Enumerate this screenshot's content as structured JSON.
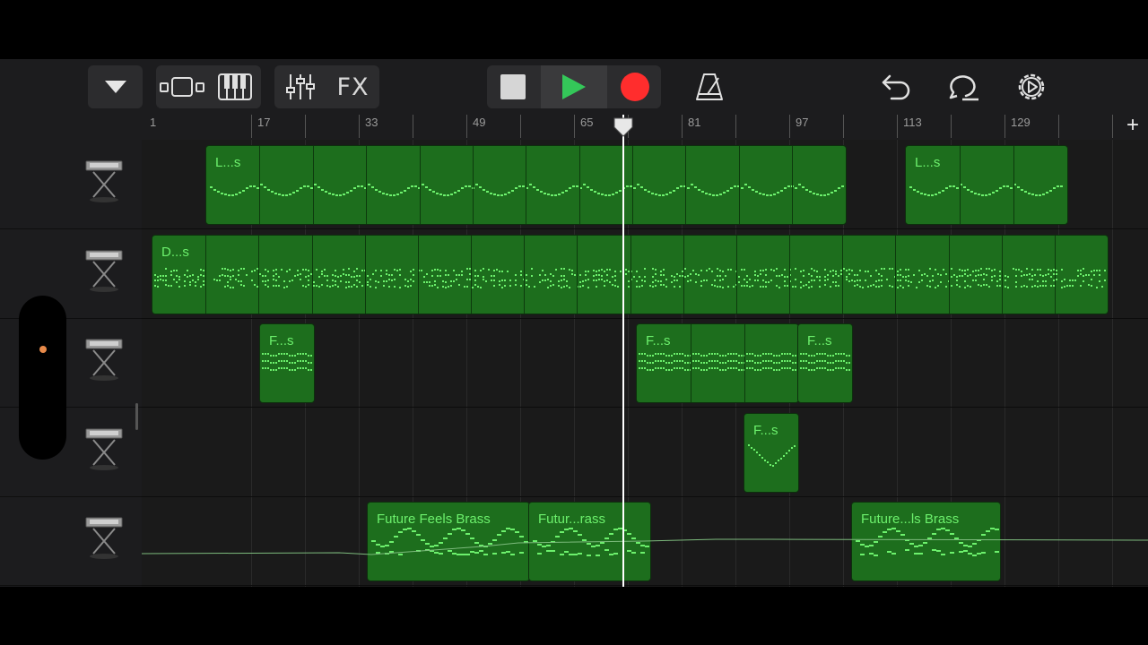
{
  "toolbar": {
    "fx_label": "FX",
    "icons": [
      "tracks-view-chevron-icon",
      "track-view-icon",
      "keyboard-icon",
      "mixer-icon",
      "stop-icon",
      "play-icon",
      "record-icon",
      "metronome-icon",
      "undo-icon",
      "loop-icon",
      "settings-icon"
    ],
    "colors": {
      "play": "#34c759",
      "record": "#ff2d2d",
      "region": "#1d6e1d",
      "notes": "#6cf06c"
    }
  },
  "ruler": {
    "labels": [
      "1",
      "17",
      "33",
      "49",
      "65",
      "81",
      "97",
      "113",
      "129"
    ],
    "add_label": "+"
  },
  "playhead_bar": 70,
  "tracks": [
    {
      "name": "track-1",
      "regions": [
        {
          "label": "L...s",
          "start": 9,
          "end": 104,
          "segments": 12,
          "pattern": "melody"
        },
        {
          "label": "L...s",
          "start": 113,
          "end": 137,
          "segments": 3,
          "pattern": "melody"
        }
      ]
    },
    {
      "name": "track-2",
      "regions": [
        {
          "label": "D...s",
          "start": 1,
          "end": 143,
          "segments": 18,
          "pattern": "drums"
        }
      ]
    },
    {
      "name": "track-3",
      "regions": [
        {
          "label": "F...s",
          "start": 17,
          "end": 25,
          "segments": 1,
          "pattern": "arp"
        },
        {
          "label": "F...s",
          "start": 73,
          "end": 97,
          "segments": 3,
          "pattern": "arp"
        },
        {
          "label": "F...s",
          "start": 97,
          "end": 105,
          "segments": 1,
          "pattern": "arp"
        }
      ]
    },
    {
      "name": "track-4",
      "regions": [
        {
          "label": "F...s",
          "start": 89,
          "end": 97,
          "segments": 1,
          "pattern": "v"
        }
      ]
    },
    {
      "name": "track-5",
      "regions": [
        {
          "label": "Future Feels Brass",
          "start": 33,
          "end": 57,
          "segments": 1,
          "pattern": "brass"
        },
        {
          "label": "Futur...rass",
          "start": 57,
          "end": 75,
          "segments": 1,
          "pattern": "brass"
        },
        {
          "label": "Future...ls Brass",
          "start": 105,
          "end": 127,
          "segments": 1,
          "pattern": "brass"
        }
      ]
    }
  ]
}
